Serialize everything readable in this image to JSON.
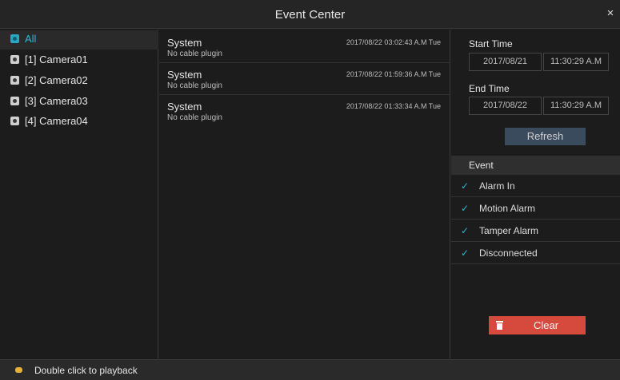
{
  "window": {
    "title": "Event Center",
    "close_glyph": "×"
  },
  "cameras": [
    {
      "label": "All",
      "icon": "camera-icon",
      "selected": true
    },
    {
      "label": "[1] Camera01",
      "icon": "camera-icon"
    },
    {
      "label": "[2] Camera02",
      "icon": "camera-icon"
    },
    {
      "label": "[3] Camera03",
      "icon": "camera-icon"
    },
    {
      "label": "[4] Camera04",
      "icon": "camera-icon"
    }
  ],
  "events": [
    {
      "type": "System",
      "desc": "No cable plugin",
      "time": "2017/08/22 03:02:43 A.M Tue"
    },
    {
      "type": "System",
      "desc": "No cable plugin",
      "time": "2017/08/22 01:59:36 A.M Tue"
    },
    {
      "type": "System",
      "desc": "No cable plugin",
      "time": "2017/08/22 01:33:34 A.M Tue"
    }
  ],
  "filter": {
    "start_label": "Start Time",
    "start_date": "2017/08/21",
    "start_time": "11:30:29 A.M",
    "end_label": "End Time",
    "end_date": "2017/08/22",
    "end_time": "11:30:29 A.M",
    "refresh_label": "Refresh",
    "event_header": "Event",
    "check_glyph": "✓",
    "options": [
      {
        "label": "Alarm In",
        "checked": true
      },
      {
        "label": "Motion Alarm",
        "checked": true
      },
      {
        "label": "Tamper Alarm",
        "checked": true
      },
      {
        "label": "Disconnected",
        "checked": true
      }
    ],
    "clear_label": "Clear"
  },
  "status": {
    "tip": "Double click to playback"
  },
  "colors": {
    "accent": "#2fb6d6",
    "danger": "#d64a3d",
    "button": "#3b4b5e",
    "background": "#1c1c1c"
  }
}
